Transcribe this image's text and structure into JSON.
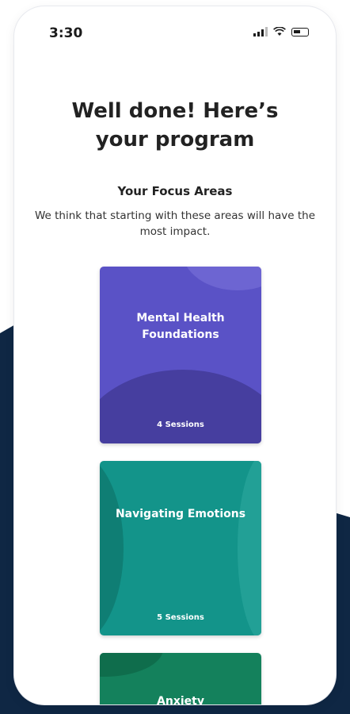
{
  "status_bar": {
    "time": "3:30"
  },
  "header": {
    "title_line1": "Well done! Here’s",
    "title_line2": "your program"
  },
  "focus": {
    "title": "Your Focus Areas",
    "description": "We think that starting with these areas will have the most impact."
  },
  "cards": [
    {
      "title_line1": "Mental Health",
      "title_line2": "Foundations",
      "sessions": "4 Sessions",
      "color": "#5a52c6"
    },
    {
      "title_line1": "Navigating Emotions",
      "sessions": "5 Sessions",
      "color": "#13948a"
    },
    {
      "title_line1": "Anxiety",
      "color": "#14815c"
    }
  ],
  "colors": {
    "background_navy": "#0f2744"
  }
}
